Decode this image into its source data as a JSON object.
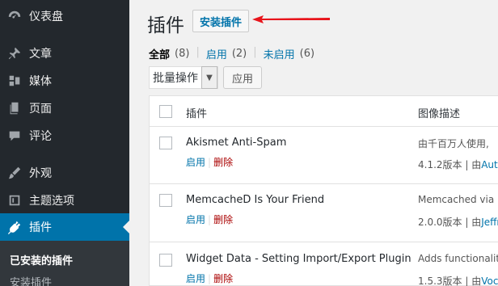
{
  "sidebar": {
    "items": [
      {
        "label": "仪表盘",
        "icon": "dashboard-icon"
      },
      {
        "label": "文章",
        "icon": "pin-icon"
      },
      {
        "label": "媒体",
        "icon": "media-icon"
      },
      {
        "label": "页面",
        "icon": "page-icon"
      },
      {
        "label": "评论",
        "icon": "comment-icon"
      },
      {
        "label": "外观",
        "icon": "appearance-icon"
      },
      {
        "label": "主题选项",
        "icon": "theme-options-icon"
      },
      {
        "label": "插件",
        "icon": "plugin-icon"
      }
    ],
    "submenu": [
      {
        "label": "已安装的插件"
      },
      {
        "label": "安装插件"
      }
    ]
  },
  "header": {
    "title": "插件",
    "add_new_label": "安装插件"
  },
  "filters": {
    "all_label": "全部",
    "all_count": "(8)",
    "active_label": "启用",
    "active_count": "(2)",
    "inactive_label": "未启用",
    "inactive_count": "(6)"
  },
  "bulk": {
    "select_value": "批量操作",
    "apply_label": "应用"
  },
  "table": {
    "headers": {
      "plugin": "插件",
      "description": "图像描述"
    },
    "rows": [
      {
        "name": "Akismet Anti-Spam",
        "activate": "启用",
        "delete": "删除",
        "desc": "由千百万人使用,",
        "version": "4.1.2版本 | 由",
        "author": "Autom"
      },
      {
        "name": "MemcacheD Is Your Friend",
        "activate": "启用",
        "delete": "删除",
        "desc": "Memcached via P",
        "version": "2.0.0版本 | 由",
        "author": "Jeffr"
      },
      {
        "name": "Widget Data - Setting Import/Export Plugin",
        "activate": "启用",
        "delete": "删除",
        "desc": "Adds functionality",
        "version": "1.5.3版本 | 由",
        "author": "Voce"
      }
    ]
  },
  "colors": {
    "sidebar_bg": "#23282d",
    "accent": "#0073aa",
    "delete": "#aa0000",
    "annotation_arrow": "#e8141b"
  }
}
